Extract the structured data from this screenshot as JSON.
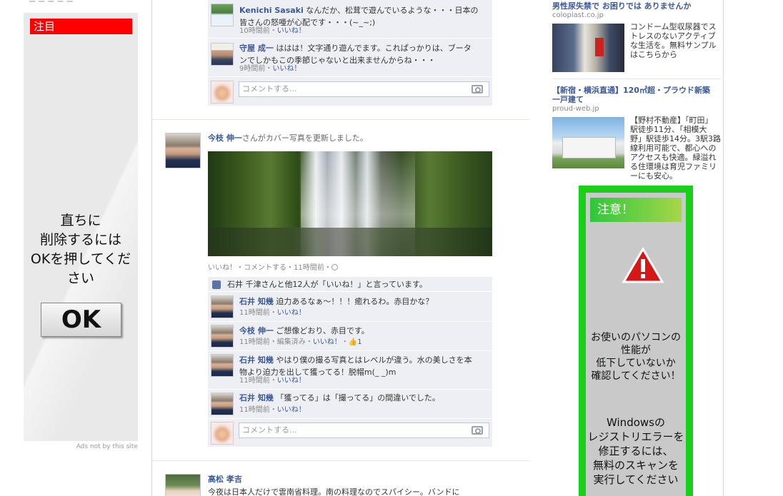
{
  "left_ad": {
    "badge": "注目",
    "message_lines": [
      "直ちに",
      "削除するには",
      "OKを押してくだ",
      "さい"
    ],
    "ok_label": "OK",
    "ads_note": "Ads not by this site",
    "top_fragment": "ー ー ー ー ー"
  },
  "post1": {
    "comments": [
      {
        "name": "Kenichi Sasaki",
        "text_line1": "なんだか、松茸で遊んでいるような・・・日本の",
        "text_line2": "皆さんの怒唖が心配です・・・(~_~;)",
        "time": "10時間前",
        "like": "いいね！"
      },
      {
        "name": "守屋 成一",
        "text_line1": "ははは！文字通り遊んでます。これぱっかりは、ブータ",
        "text_line2": "ンでしかもこの季節じゃないと出来ませんからね・・・",
        "time": "9時間前",
        "like": "いいね！"
      }
    ],
    "comment_placeholder": "コメントする..."
  },
  "post2": {
    "author": "今枝 伸一",
    "action": "さんがカバー写真を更新しました。",
    "actions_line": "いいね！・コメントする・11時間前・",
    "likes_line": "石井 千津さんと他12人が「いいね！」と言っています。",
    "comments": [
      {
        "name": "石井 知幾",
        "text": "迫力あるなぁ～！！！癒れるわ。赤目かな？",
        "meta": "11時間前・",
        "like": "いいね！"
      },
      {
        "name": "今枝 伸一",
        "text": "ご想像どおり、赤目です。",
        "meta": "11時間前・編集済み・",
        "like": "いいね！",
        "like_count": "1"
      },
      {
        "name": "石井 知幾",
        "text_line1": "やはり僕の撮る写真とはレベルが違う。水の美しさを本",
        "text_line2": "物より迫力を出して獲ってる！脱帽m(_ _)m",
        "meta": "11時間前・",
        "like": "いいね！"
      },
      {
        "name": "石井 知幾",
        "text": "「獲ってる」は「撮ってる」の間違いでした。",
        "meta": "11時間前・",
        "like": "いいね！"
      }
    ],
    "comment_placeholder": "コメントする..."
  },
  "post3": {
    "author": "高松 孝吉",
    "text": "今夜は日本人だけで雲南省料理。南の料理なのでスパイシー。バンドに"
  },
  "right_ads": [
    {
      "title": "男性尿失禁で お困りでは ありませんか",
      "url": "coloplast.co.jp",
      "body": [
        "コンドーム型収尿器でス",
        "トレスのないアクティブ",
        "な生活を。無料サンプル",
        "はこちらから"
      ]
    },
    {
      "title": "【新宿・横浜直通】120㎡超・プラウド新築一戸建て",
      "title_lines": [
        "【新宿・横浜直通】120㎡超・プラウド新築",
        "一戸建て"
      ],
      "url": "proud-web.jp",
      "body": [
        "【野村不動産】「町田」",
        "駅徒歩11分、「相模大",
        "野」駅徒歩14分。3駅3路",
        "線利用可能で、都心への",
        "アクセスも快適。緑溢れ",
        "る住環境は育児ファミリ",
        "ーにも安心。"
      ]
    }
  ],
  "warning_ad": {
    "header": "注意！",
    "text1_lines": [
      "お使いのパソコンの",
      "性能が",
      "低下していないか",
      "確認してください！"
    ],
    "text2_lines": [
      "Windowsの",
      "レジストリエラーを",
      "修正するには、",
      "無料のスキャンを",
      "実行してください"
    ]
  },
  "colors": {
    "facebook_blue": "#3b5998",
    "warning_green": "#18d018",
    "badge_red": "#ff0000"
  }
}
